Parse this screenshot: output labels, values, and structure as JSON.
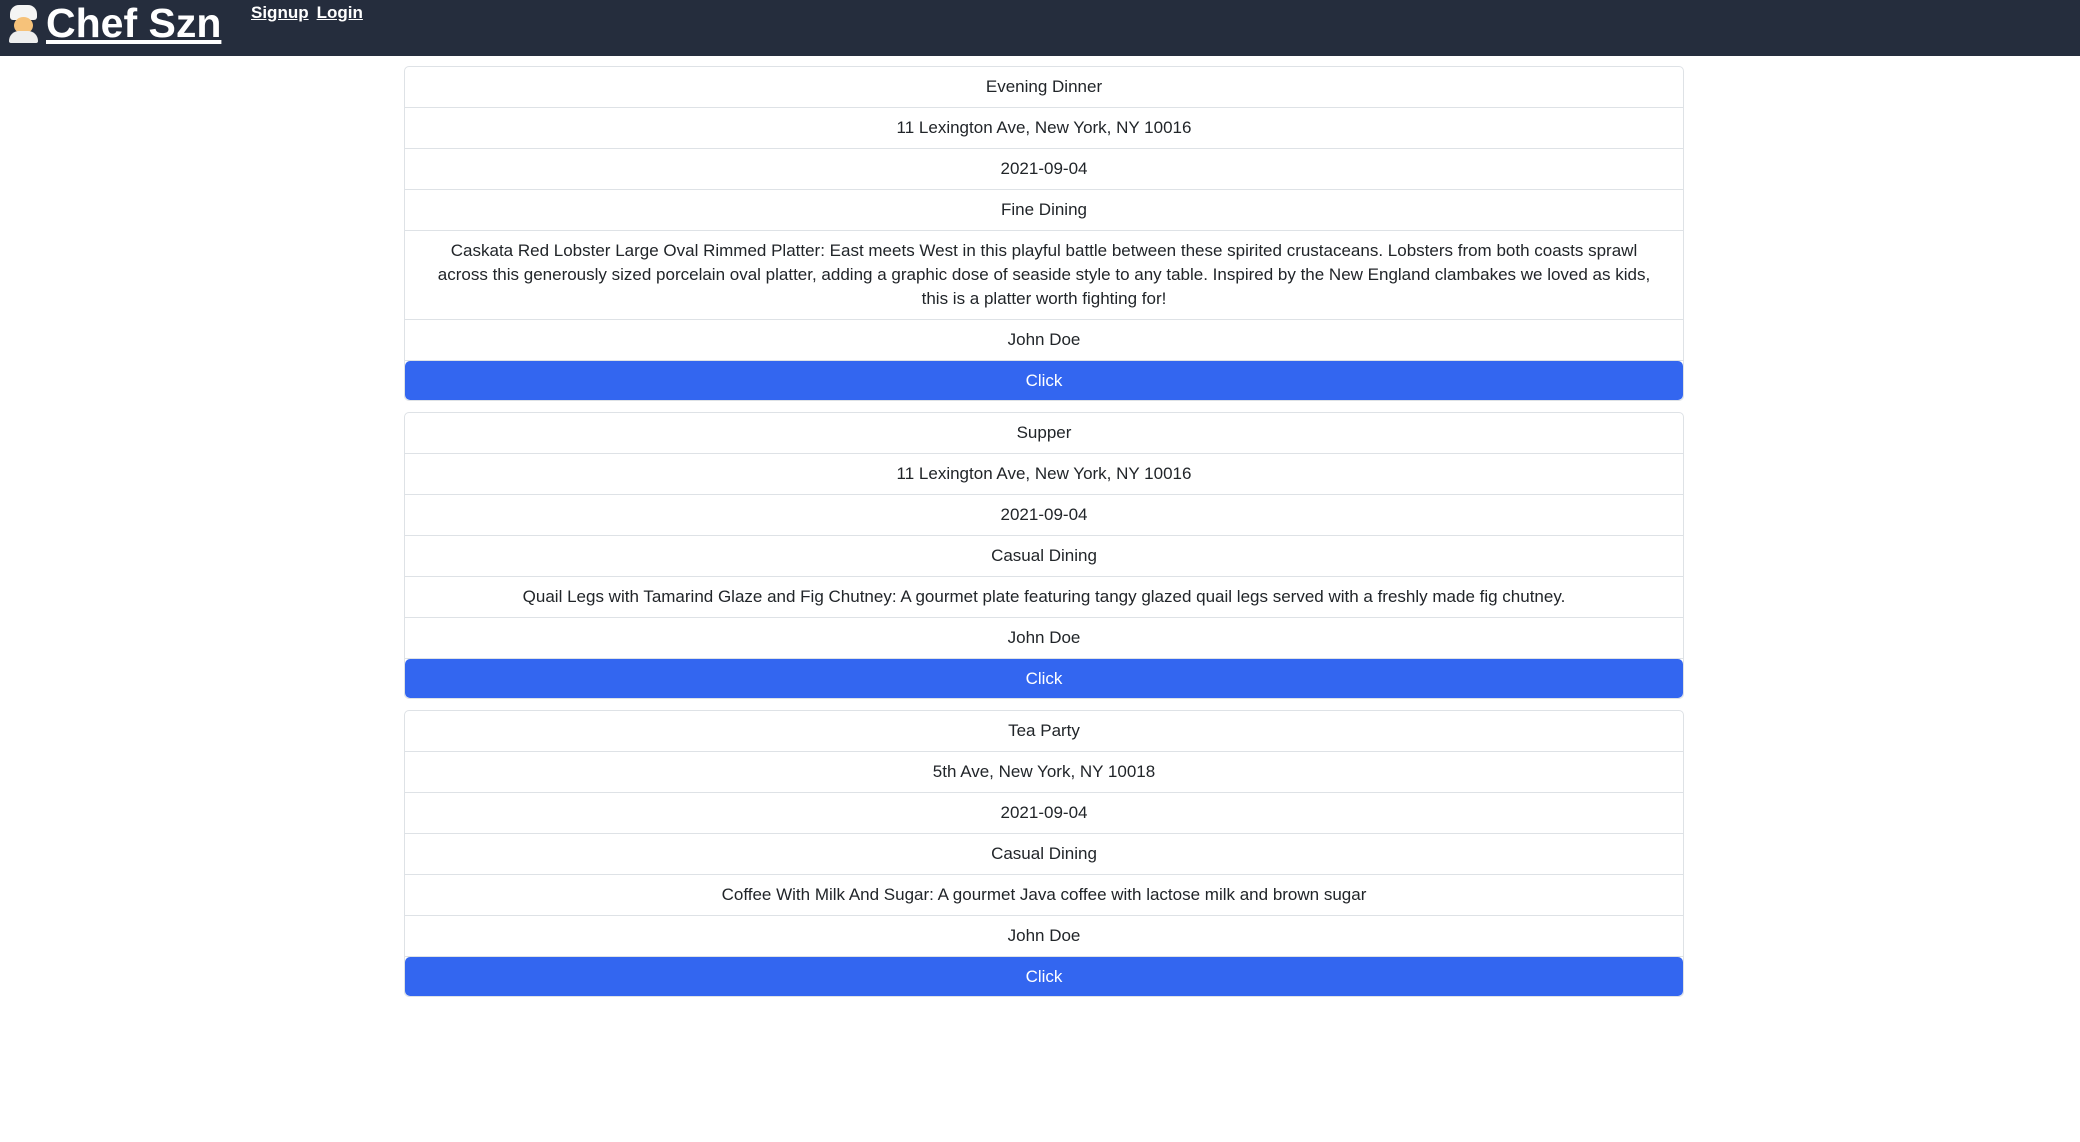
{
  "navbar": {
    "brand": "Chef Szn",
    "brand_icon": "chef-icon",
    "links": [
      "Signup",
      "Login"
    ]
  },
  "events": [
    {
      "name": "Evening Dinner",
      "address": "11 Lexington Ave, New York, NY 10016",
      "date": "2021-09-04",
      "category": "Fine Dining",
      "description": "Caskata Red Lobster Large Oval Rimmed Platter: East meets West in this playful battle between these spirited crustaceans. Lobsters from both coasts sprawl across this generously sized porcelain oval platter, adding a graphic dose of seaside style to any table. Inspired by the New England clambakes we loved as kids, this is a platter worth fighting for!",
      "host": "John Doe",
      "button_label": "Click"
    },
    {
      "name": "Supper",
      "address": "11 Lexington Ave, New York, NY 10016",
      "date": "2021-09-04",
      "category": "Casual Dining",
      "description": "Quail Legs with Tamarind Glaze and Fig Chutney: A gourmet plate featuring tangy glazed quail legs served with a freshly made fig chutney.",
      "host": "John Doe",
      "button_label": "Click"
    },
    {
      "name": "Tea Party",
      "address": "5th Ave, New York, NY 10018",
      "date": "2021-09-04",
      "category": "Casual Dining",
      "description": "Coffee With Milk And Sugar: A gourmet Java coffee with lactose milk and brown sugar",
      "host": "John Doe",
      "button_label": "Click"
    }
  ],
  "colors": {
    "navbar_bg": "#252d3d",
    "button_bg": "#3366f0",
    "border": "#dee2e6"
  }
}
